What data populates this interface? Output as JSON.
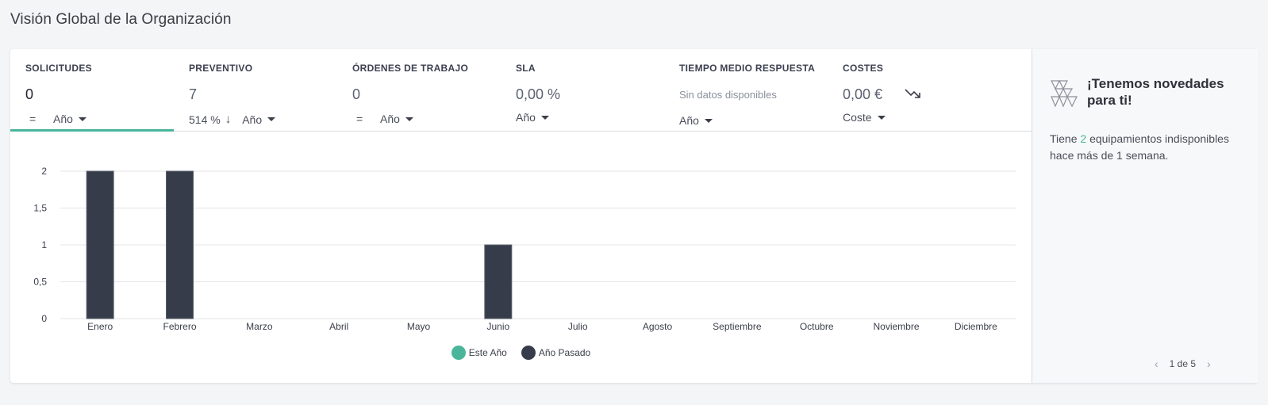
{
  "page": {
    "title": "Visión Global de la Organización"
  },
  "kpis": [
    {
      "label": "SOLICITUDES",
      "value": "0",
      "trend": "=",
      "period": "Año"
    },
    {
      "label": "PREVENTIVO",
      "value": "7",
      "trend_pct": "514 %",
      "trend_arrow": "↓",
      "period": "Año"
    },
    {
      "label": "ÓRDENES DE TRABAJO",
      "value": "0",
      "trend": "=",
      "period": "Año"
    },
    {
      "label": "SLA",
      "value": "0,00 %",
      "period": "Año"
    },
    {
      "label": "TIEMPO MEDIO RESPUESTA",
      "value": "Sin datos disponibles",
      "period": "Año"
    },
    {
      "label": "COSTES",
      "value": "0,00 €",
      "period": "Coste",
      "trend_icon": "trending-down-icon"
    }
  ],
  "chart_data": {
    "type": "bar",
    "categories": [
      "Enero",
      "Febrero",
      "Marzo",
      "Abril",
      "Mayo",
      "Junio",
      "Julio",
      "Agosto",
      "Septiembre",
      "Octubre",
      "Noviembre",
      "Diciembre"
    ],
    "series": [
      {
        "name": "Este Año",
        "color": "#4ab59a",
        "values": [
          0,
          0,
          0,
          0,
          0,
          0,
          0,
          0,
          0,
          0,
          0,
          0
        ]
      },
      {
        "name": "Año Pasado",
        "color": "#373c4a",
        "values": [
          2,
          2,
          0,
          0,
          0,
          1,
          0,
          0,
          0,
          0,
          0,
          0
        ]
      }
    ],
    "yticks": [
      "0",
      "0,5",
      "1",
      "1,5",
      "2"
    ],
    "ylim": [
      0,
      2
    ],
    "grid": true,
    "legend": "bottom-center"
  },
  "side": {
    "logo_icon": "triangles-logo-icon",
    "title": "¡Tenemos novedades para ti!",
    "text_prefix": "Tiene ",
    "text_count": "2",
    "text_suffix": " equipamientos indisponibles hace más de 1 semana.",
    "pager": {
      "prev": "‹",
      "label": "1 de 5",
      "next": "›"
    }
  }
}
